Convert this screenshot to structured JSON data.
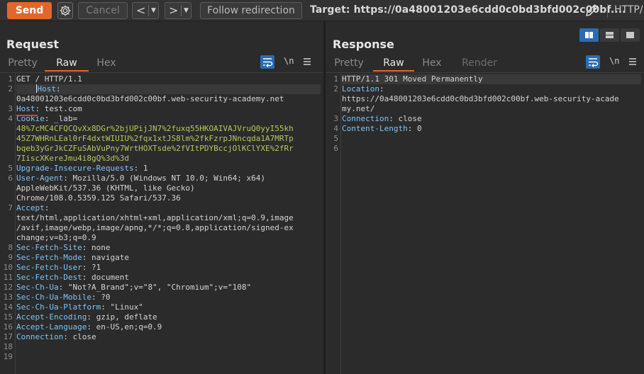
{
  "toolbar": {
    "send": "Send",
    "cancel": "Cancel",
    "back": "<",
    "forward": ">",
    "follow": "Follow redirection",
    "target": "Target: https://0a48001203e6cdd0c0bd3bfd002c00bf....",
    "http_version": "HTTP/1"
  },
  "request": {
    "title": "Request",
    "tabs": [
      "Pretty",
      "Raw",
      "Hex"
    ],
    "active_tab": "Raw",
    "newline_toggle": "\\n",
    "lines": [
      {
        "num": "1",
        "segments": [
          {
            "t": "GET / HTTP/1.1",
            "c": ""
          }
        ]
      },
      {
        "num": "2",
        "segments": [
          {
            "t": "    ",
            "c": ""
          },
          {
            "t": "Host",
            "c": "k"
          },
          {
            "t": ":",
            "c": ""
          }
        ],
        "highlight": true,
        "cursor": true
      },
      {
        "num": "",
        "segments": [
          {
            "t": "0a48001203e6cdd0c0bd3bfd002c00bf.web-security-academy.net",
            "c": ""
          }
        ]
      },
      {
        "num": "3",
        "segments": [
          {
            "t": "Host",
            "c": "k"
          },
          {
            "t": ": test.com",
            "c": ""
          }
        ]
      },
      {
        "num": "4",
        "segments": [
          {
            "t": "Cookie",
            "c": "k"
          },
          {
            "t": ": _lab=",
            "c": ""
          }
        ]
      },
      {
        "num": "",
        "segments": [
          {
            "t": "48%7cMC4CFQCQvXx8DGr%2bjUPijJN7%2fuxq55HKOAIVAJVruQ0yyI55kh",
            "c": "cookie"
          }
        ]
      },
      {
        "num": "",
        "segments": [
          {
            "t": "45Z7WHRnLEal0rF4dxtWIUIU%2fqx1xtJS8lm%2fkFzrpJNncqda1A7MRTp",
            "c": "cookie"
          }
        ]
      },
      {
        "num": "",
        "segments": [
          {
            "t": "bqeb3yGrJkCZFuSAbVuPny7WrtHOXTsde%2fVItPDYBccjOlKClYXE%2fRr",
            "c": "cookie"
          }
        ]
      },
      {
        "num": "",
        "segments": [
          {
            "t": "7IiscXKereJmu4i8gQ%3d%3d",
            "c": "cookie"
          }
        ]
      },
      {
        "num": "5",
        "segments": [
          {
            "t": "Upgrade-Insecure-Requests",
            "c": "k"
          },
          {
            "t": ": 1",
            "c": ""
          }
        ]
      },
      {
        "num": "6",
        "segments": [
          {
            "t": "User-Agent",
            "c": "k"
          },
          {
            "t": ": Mozilla/5.0 (Windows NT 10.0; Win64; x64)",
            "c": ""
          }
        ]
      },
      {
        "num": "",
        "segments": [
          {
            "t": "AppleWebKit/537.36 (KHTML, like Gecko)",
            "c": ""
          }
        ]
      },
      {
        "num": "",
        "segments": [
          {
            "t": "Chrome/108.0.5359.125 Safari/537.36",
            "c": ""
          }
        ]
      },
      {
        "num": "7",
        "segments": [
          {
            "t": "Accept",
            "c": "k"
          },
          {
            "t": ":",
            "c": ""
          }
        ]
      },
      {
        "num": "",
        "segments": [
          {
            "t": "text/html,application/xhtml+xml,application/xml;q=0.9,image",
            "c": ""
          }
        ]
      },
      {
        "num": "",
        "segments": [
          {
            "t": "/avif,image/webp,image/apng,*/*;q=0.8,application/signed-ex",
            "c": ""
          }
        ]
      },
      {
        "num": "",
        "segments": [
          {
            "t": "change;v=b3;q=0.9",
            "c": ""
          }
        ]
      },
      {
        "num": "8",
        "segments": [
          {
            "t": "Sec-Fetch-Site",
            "c": "k"
          },
          {
            "t": ": none",
            "c": ""
          }
        ]
      },
      {
        "num": "9",
        "segments": [
          {
            "t": "Sec-Fetch-Mode",
            "c": "k"
          },
          {
            "t": ": navigate",
            "c": ""
          }
        ]
      },
      {
        "num": "10",
        "segments": [
          {
            "t": "Sec-Fetch-User",
            "c": "k"
          },
          {
            "t": ": ?1",
            "c": ""
          }
        ]
      },
      {
        "num": "11",
        "segments": [
          {
            "t": "Sec-Fetch-Dest",
            "c": "k"
          },
          {
            "t": ": document",
            "c": ""
          }
        ]
      },
      {
        "num": "12",
        "segments": [
          {
            "t": "Sec-Ch-Ua",
            "c": "k"
          },
          {
            "t": ": \"Not?A_Brand\";v=\"8\", \"Chromium\";v=\"108\"",
            "c": ""
          }
        ]
      },
      {
        "num": "13",
        "segments": [
          {
            "t": "Sec-Ch-Ua-Mobile",
            "c": "k"
          },
          {
            "t": ": ?0",
            "c": ""
          }
        ]
      },
      {
        "num": "14",
        "segments": [
          {
            "t": "Sec-Ch-Ua-Platform",
            "c": "k"
          },
          {
            "t": ": \"Linux\"",
            "c": ""
          }
        ]
      },
      {
        "num": "15",
        "segments": [
          {
            "t": "Accept-Encoding",
            "c": "k"
          },
          {
            "t": ": gzip, deflate",
            "c": ""
          }
        ]
      },
      {
        "num": "16",
        "segments": [
          {
            "t": "Accept-Language",
            "c": "k"
          },
          {
            "t": ": en-US,en;q=0.9",
            "c": ""
          }
        ]
      },
      {
        "num": "17",
        "segments": [
          {
            "t": "Connection",
            "c": "k"
          },
          {
            "t": ": close",
            "c": ""
          }
        ]
      },
      {
        "num": "18",
        "segments": [
          {
            "t": "",
            "c": ""
          }
        ]
      },
      {
        "num": "19",
        "segments": [
          {
            "t": "",
            "c": ""
          }
        ]
      }
    ]
  },
  "response": {
    "title": "Response",
    "tabs": [
      "Pretty",
      "Raw",
      "Hex",
      "Render"
    ],
    "active_tab": "Raw",
    "newline_toggle": "\\n",
    "lines": [
      {
        "num": "1",
        "segments": [
          {
            "t": "HTTP/1.1 301 Moved Permanently",
            "c": ""
          }
        ],
        "highlight": true
      },
      {
        "num": "2",
        "segments": [
          {
            "t": "Location",
            "c": "k"
          },
          {
            "t": ":",
            "c": ""
          }
        ]
      },
      {
        "num": "",
        "segments": [
          {
            "t": "https://0a48001203e6cdd0c0bd3bfd002c00bf.web-security-acade",
            "c": ""
          }
        ]
      },
      {
        "num": "",
        "segments": [
          {
            "t": "my.net/",
            "c": ""
          }
        ]
      },
      {
        "num": "3",
        "segments": [
          {
            "t": "Connection",
            "c": "k"
          },
          {
            "t": ": close",
            "c": ""
          }
        ]
      },
      {
        "num": "4",
        "segments": [
          {
            "t": "Content-Length",
            "c": "k"
          },
          {
            "t": ": 0",
            "c": ""
          }
        ]
      },
      {
        "num": "5",
        "segments": [
          {
            "t": "",
            "c": ""
          }
        ]
      },
      {
        "num": "6",
        "segments": [
          {
            "t": "",
            "c": ""
          }
        ]
      }
    ]
  },
  "colors": {
    "accent": "#e2672b",
    "header_key": "#7ec3f5",
    "cookie_value": "#b5c95b",
    "toggle_active": "#2b6cb0",
    "error_underline": "#e03c3c"
  },
  "icons": [
    "gear-icon",
    "pencil-icon",
    "wrap-icon",
    "newline-icon",
    "menu-icon",
    "layout-side-by-side-icon",
    "layout-stacked-icon",
    "layout-single-icon"
  ]
}
